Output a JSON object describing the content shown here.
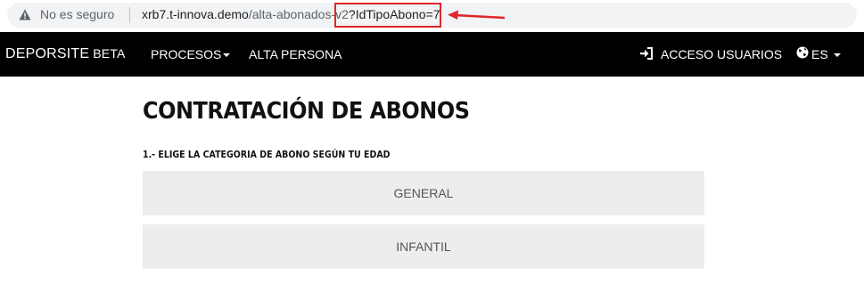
{
  "address_bar": {
    "security_label": "No es seguro",
    "url_host": "xrb7.t-innova.demo",
    "url_path": "/alta-abonados-v2",
    "url_query": "?IdTipoAbono=7"
  },
  "annotation_color": "#e0262a",
  "navbar": {
    "brand": "DEPORSITE",
    "brand_suffix": "BETA",
    "menu_procesos": "PROCESOS",
    "menu_alta": "ALTA PERSONA",
    "access_label": "ACCESO USUARIOS",
    "lang_label": "ES"
  },
  "main": {
    "title": "CONTRATACIÓN DE ABONOS",
    "step_label": "1.- ELIGE LA CATEGORIA DE ABONO SEGÚN TU EDAD",
    "options": [
      "GENERAL",
      "INFANTIL"
    ]
  }
}
